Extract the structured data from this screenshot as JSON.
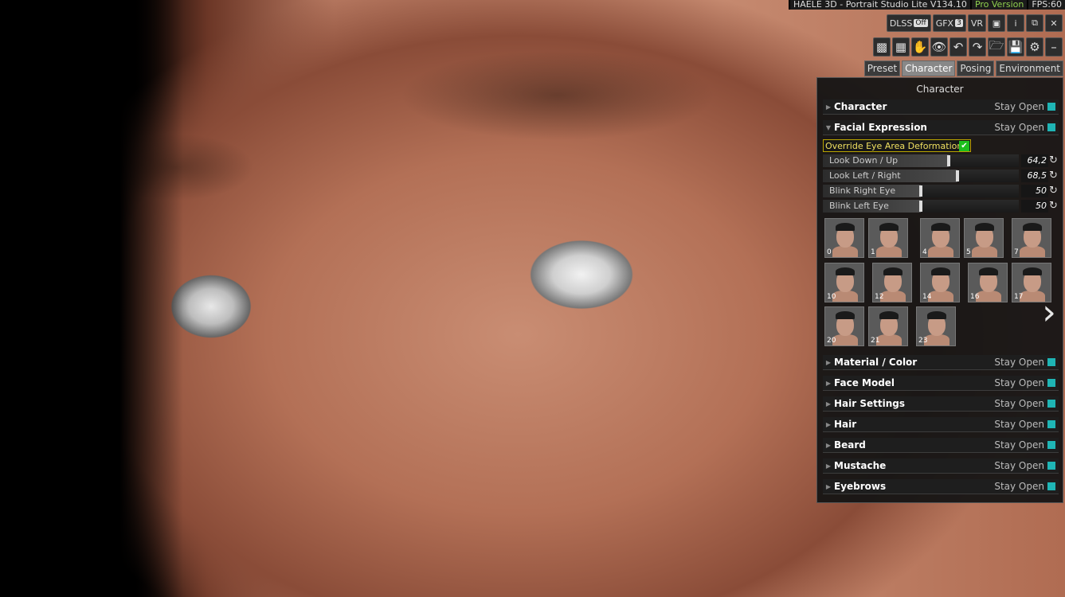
{
  "status": {
    "app_title": "HAELE 3D - Portrait Studio Lite V134.10",
    "version": "Pro Version",
    "fps": "FPS:60"
  },
  "toolbar": {
    "dlss_label": "DLSS",
    "dlss_value": "Off",
    "gfx_label": "GFX",
    "gfx_value": "3",
    "vr_label": "VR",
    "info_label": "i"
  },
  "tabs": [
    "Preset",
    "Character",
    "Posing",
    "Environment"
  ],
  "active_tab": "Character",
  "panel": {
    "title": "Character",
    "stay_open": "Stay Open",
    "sections_top": [
      {
        "name": "Character",
        "open": false
      },
      {
        "name": "Facial Expression",
        "open": true
      }
    ],
    "override_label": "Override Eye Area Deformation",
    "override_checked": true,
    "sliders": [
      {
        "label": "Look Down / Up",
        "value": "64,2",
        "fraction": 0.642
      },
      {
        "label": "Look Left / Right",
        "value": "68,5",
        "fraction": 0.685
      },
      {
        "label": "Blink Right Eye",
        "value": "50",
        "fraction": 0.5
      },
      {
        "label": "Blink Left Eye",
        "value": "50",
        "fraction": 0.5
      }
    ],
    "expression_thumbnails": [
      "0",
      "1",
      "4",
      "5",
      "7",
      "10",
      "12",
      "14",
      "16",
      "17",
      "20",
      "21",
      "23"
    ],
    "sections_bottom": [
      {
        "name": "Material / Color"
      },
      {
        "name": "Face Model"
      },
      {
        "name": "Hair Settings"
      },
      {
        "name": "Hair"
      },
      {
        "name": "Beard"
      },
      {
        "name": "Mustache"
      },
      {
        "name": "Eyebrows"
      }
    ]
  },
  "colors": {
    "stay_open_accent": "#1fb5b5",
    "checkbox_green": "#1dbf1d",
    "override_border": "#b9a400",
    "pro_text": "#8fd14f"
  }
}
